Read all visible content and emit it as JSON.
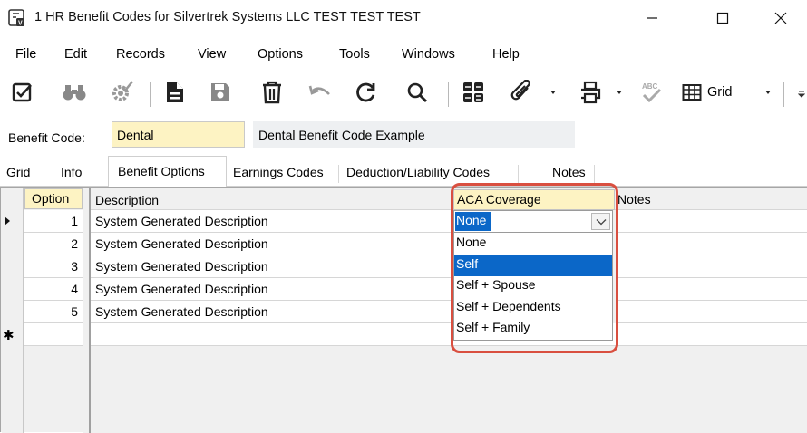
{
  "window": {
    "title": "1 HR Benefit Codes for Silvertrek Systems LLC TEST TEST TEST",
    "minimize_glyph": "—",
    "maximize_glyph": "☐",
    "close_glyph": "✕"
  },
  "menu": [
    "File",
    "Edit",
    "Records",
    "View",
    "Options",
    "Tools",
    "Windows",
    "Help"
  ],
  "toolbar": {
    "grid_label": "Grid",
    "icons": [
      "checkmark-box-icon",
      "binoculars-icon",
      "gear-check-icon",
      "document-icon",
      "save-icon",
      "trash-icon",
      "undo-icon",
      "refresh-icon",
      "search-icon",
      "calculator-icon",
      "paperclip-icon",
      "print-icon",
      "spellcheck-icon",
      "grid-icon"
    ]
  },
  "benefit_code": {
    "label": "Benefit Code:",
    "value": "Dental",
    "description": "Dental Benefit Code Example"
  },
  "tabs": [
    "Grid",
    "Info",
    "Benefit Options",
    "Earnings Codes",
    "Deduction/Liability Codes",
    "Notes"
  ],
  "active_tab": "Benefit Options",
  "grid": {
    "headers": {
      "option": "Option",
      "description": "Description",
      "aca": "ACA Coverage",
      "notes": "Notes"
    },
    "rows": [
      {
        "option": "1",
        "description": "System Generated Description"
      },
      {
        "option": "2",
        "description": "System Generated Description"
      },
      {
        "option": "3",
        "description": "System Generated Description"
      },
      {
        "option": "4",
        "description": "System Generated Description"
      },
      {
        "option": "5",
        "description": "System Generated Description"
      }
    ],
    "new_row_marker": "✱"
  },
  "aca_dropdown": {
    "current_value": "None",
    "options": [
      "None",
      "Self",
      "Self + Spouse",
      "Self + Dependents",
      "Self + Family"
    ],
    "highlighted": "Self"
  },
  "colors": {
    "accent_blue": "#0b67c8",
    "input_yellow": "#fdf3c3",
    "highlight_red": "#d94f40"
  }
}
